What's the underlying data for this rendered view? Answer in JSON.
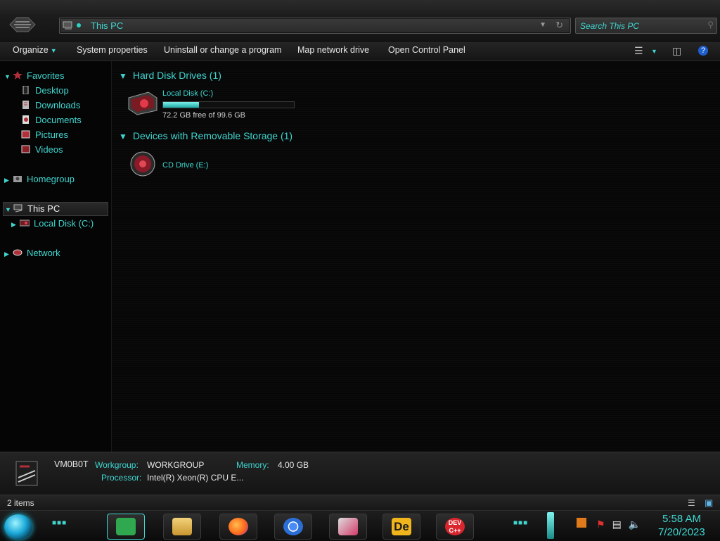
{
  "address": {
    "crumb": "This PC"
  },
  "search": {
    "placeholder": "Search This PC"
  },
  "toolbar": {
    "organize": "Organize",
    "system_properties": "System properties",
    "uninstall": "Uninstall or change a program",
    "map_drive": "Map network drive",
    "control_panel": "Open Control Panel"
  },
  "sidebar": {
    "favorites": "Favorites",
    "desktop": "Desktop",
    "downloads": "Downloads",
    "documents": "Documents",
    "pictures": "Pictures",
    "videos": "Videos",
    "homegroup": "Homegroup",
    "this_pc": "This PC",
    "local_disk": "Local Disk (C:)",
    "network": "Network"
  },
  "content": {
    "hdd_header": "Hard Disk Drives (1)",
    "local_disk_label": "Local Disk (C:)",
    "local_disk_free": "72.2 GB free of 99.6 GB",
    "local_disk_used_fraction": 0.275,
    "removable_header": "Devices with Removable Storage (1)",
    "cd_label": "CD Drive (E:)"
  },
  "details": {
    "computer_name": "VM0B0T",
    "workgroup_key": "Workgroup:",
    "workgroup_val": "WORKGROUP",
    "memory_key": "Memory:",
    "memory_val": "4.00 GB",
    "processor_key": "Processor:",
    "processor_val": "Intel(R) Xeon(R) CPU E..."
  },
  "status": {
    "count": "2 items"
  },
  "taskbar": {
    "apps": [
      "notes",
      "file-explorer",
      "firefox",
      "chrome",
      "media-app",
      "de-app",
      "dev-cpp"
    ],
    "dev_label": "DEV\nC++",
    "de_label": "De",
    "time": "5:58 AM",
    "date": "7/20/2023"
  },
  "colors": {
    "accent": "#3fd6d0",
    "background": "#050505"
  }
}
